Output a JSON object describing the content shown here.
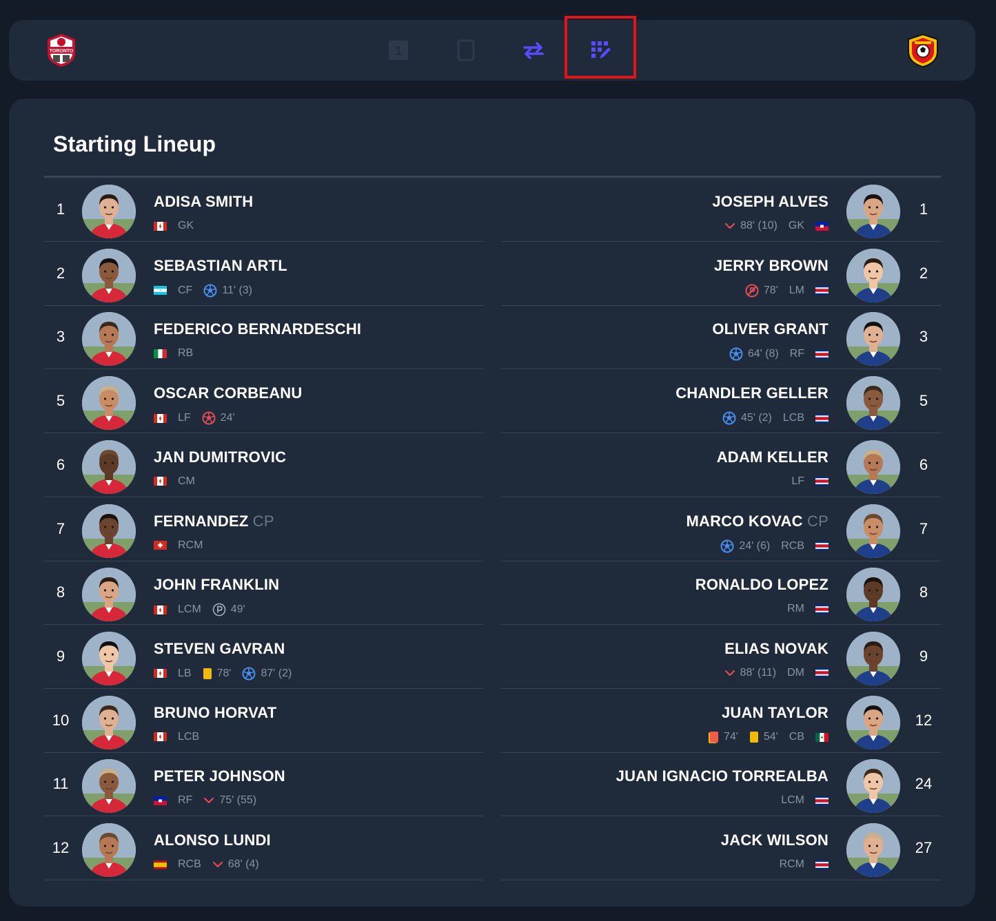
{
  "colors": {
    "background": "#131b29",
    "panel": "#1f2a3b",
    "accent": "#5b4bff",
    "highlight": "#e1141a",
    "muted": "#8a93a2",
    "goal": "#4a8df0",
    "own_goal": "#e24c56",
    "yellow_card": "#f2b90c",
    "red_card": "#f25a4a"
  },
  "header": {
    "home_crest": {
      "icon": "toronto-fc-crest",
      "text": "TORONTO"
    },
    "away_crest": {
      "icon": "herediano-crest"
    },
    "tabs": [
      {
        "id": "yellow-cards",
        "icon": "yellow-card-icon",
        "text": "1"
      },
      {
        "id": "red-cards",
        "icon": "red-card-icon"
      },
      {
        "id": "substitutions",
        "icon": "swap-arrows-icon",
        "active": true
      },
      {
        "id": "lineups",
        "icon": "lineup-edit-icon",
        "active": true,
        "highlighted": true
      }
    ]
  },
  "lineup": {
    "title": "Starting Lineup",
    "home": [
      {
        "number": "1",
        "name": "ADISA SMITH",
        "flag": "canada",
        "position": "GK",
        "events": []
      },
      {
        "number": "2",
        "name": "SEBASTIAN ARTL",
        "flag": "honduras",
        "position": "CF",
        "events": [
          {
            "icon": "goal-icon",
            "text": "11' (3)"
          }
        ]
      },
      {
        "number": "3",
        "name": "FEDERICO BERNARDESCHI",
        "flag": "italy",
        "position": "RB",
        "events": []
      },
      {
        "number": "5",
        "name": "OSCAR CORBEANU",
        "flag": "canada",
        "position": "LF",
        "events": [
          {
            "icon": "own-goal-icon",
            "text": "24'"
          }
        ]
      },
      {
        "number": "6",
        "name": "JAN DUMITROVIC",
        "flag": "canada",
        "position": "CM",
        "events": []
      },
      {
        "number": "7",
        "name": "FERNANDEZ",
        "captain": "CP",
        "flag": "switzerland",
        "position": "RCM",
        "events": []
      },
      {
        "number": "8",
        "name": "JOHN FRANKLIN",
        "flag": "canada",
        "position": "LCM",
        "events": [
          {
            "icon": "penalty-icon",
            "text": "49'"
          }
        ]
      },
      {
        "number": "9",
        "name": "STEVEN GAVRAN",
        "flag": "canada",
        "position": "LB",
        "events": [
          {
            "icon": "yellow-card-icon",
            "text": "78'"
          },
          {
            "icon": "goal-icon",
            "text": "87' (2)"
          }
        ]
      },
      {
        "number": "10",
        "name": "BRUNO HORVAT",
        "flag": "canada",
        "position": "LCB",
        "events": []
      },
      {
        "number": "11",
        "name": "PETER JOHNSON",
        "flag": "haiti",
        "position": "RF",
        "events": [
          {
            "icon": "sub-out-icon",
            "text": "75' (55)"
          }
        ]
      },
      {
        "number": "12",
        "name": "ALONSO LUNDI",
        "flag": "spain",
        "position": "RCB",
        "events": [
          {
            "icon": "sub-out-icon",
            "text": "68' (4)"
          }
        ]
      }
    ],
    "away": [
      {
        "number": "1",
        "name": "JOSEPH ALVES",
        "flag": "haiti",
        "position": "GK",
        "events": [
          {
            "icon": "sub-out-icon",
            "text": "88' (10)"
          }
        ]
      },
      {
        "number": "2",
        "name": "JERRY BROWN",
        "flag": "costa-rica",
        "position": "LM",
        "events": [
          {
            "icon": "missed-penalty-icon",
            "text": "78'"
          }
        ]
      },
      {
        "number": "3",
        "name": "OLIVER GRANT",
        "flag": "costa-rica",
        "position": "RF",
        "events": [
          {
            "icon": "goal-icon",
            "text": "64' (8)"
          }
        ]
      },
      {
        "number": "5",
        "name": "CHANDLER GELLER",
        "flag": "costa-rica",
        "position": "LCB",
        "events": [
          {
            "icon": "goal-icon",
            "text": "45' (2)"
          }
        ]
      },
      {
        "number": "6",
        "name": "ADAM KELLER",
        "flag": "costa-rica",
        "position": "LF",
        "events": []
      },
      {
        "number": "7",
        "name": "MARCO KOVAC",
        "captain": "CP",
        "flag": "costa-rica",
        "position": "RCB",
        "events": [
          {
            "icon": "goal-icon",
            "text": "24' (6)"
          }
        ]
      },
      {
        "number": "8",
        "name": "RONALDO LOPEZ",
        "flag": "costa-rica",
        "position": "RM",
        "events": []
      },
      {
        "number": "9",
        "name": "ELIAS NOVAK",
        "flag": "costa-rica",
        "position": "DM",
        "events": [
          {
            "icon": "sub-out-icon",
            "text": "88' (11)"
          }
        ]
      },
      {
        "number": "12",
        "name": "JUAN TAYLOR",
        "flag": "mexico",
        "position": "CB",
        "events": [
          {
            "icon": "red-card-icon",
            "text": "74'"
          },
          {
            "icon": "yellow-card-icon",
            "text": "54'"
          }
        ]
      },
      {
        "number": "24",
        "name": "JUAN IGNACIO TORREALBA",
        "flag": "costa-rica",
        "position": "LCM",
        "events": []
      },
      {
        "number": "27",
        "name": "JACK WILSON",
        "flag": "costa-rica",
        "position": "RCM",
        "events": []
      }
    ]
  }
}
